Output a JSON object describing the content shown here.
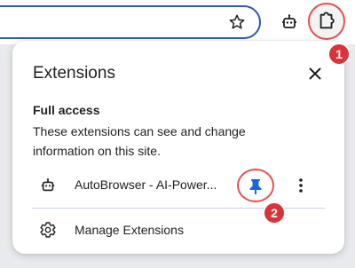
{
  "popup": {
    "title": "Extensions",
    "section_title": "Full access",
    "section_description": "These extensions can see and change information on this site.",
    "extensions": [
      {
        "name": "AutoBrowser - AI-Power...",
        "icon": "robot-icon",
        "pinned": true
      }
    ],
    "manage_label": "Manage Extensions"
  },
  "annotations": {
    "badge_1": "1",
    "badge_2": "2"
  },
  "colors": {
    "accent_blue": "#2f5ba8",
    "pin_blue": "#1a66d9",
    "annotation_red": "#d8343a",
    "popup_bg": "#ffffff",
    "page_bg": "#e9eaed"
  }
}
